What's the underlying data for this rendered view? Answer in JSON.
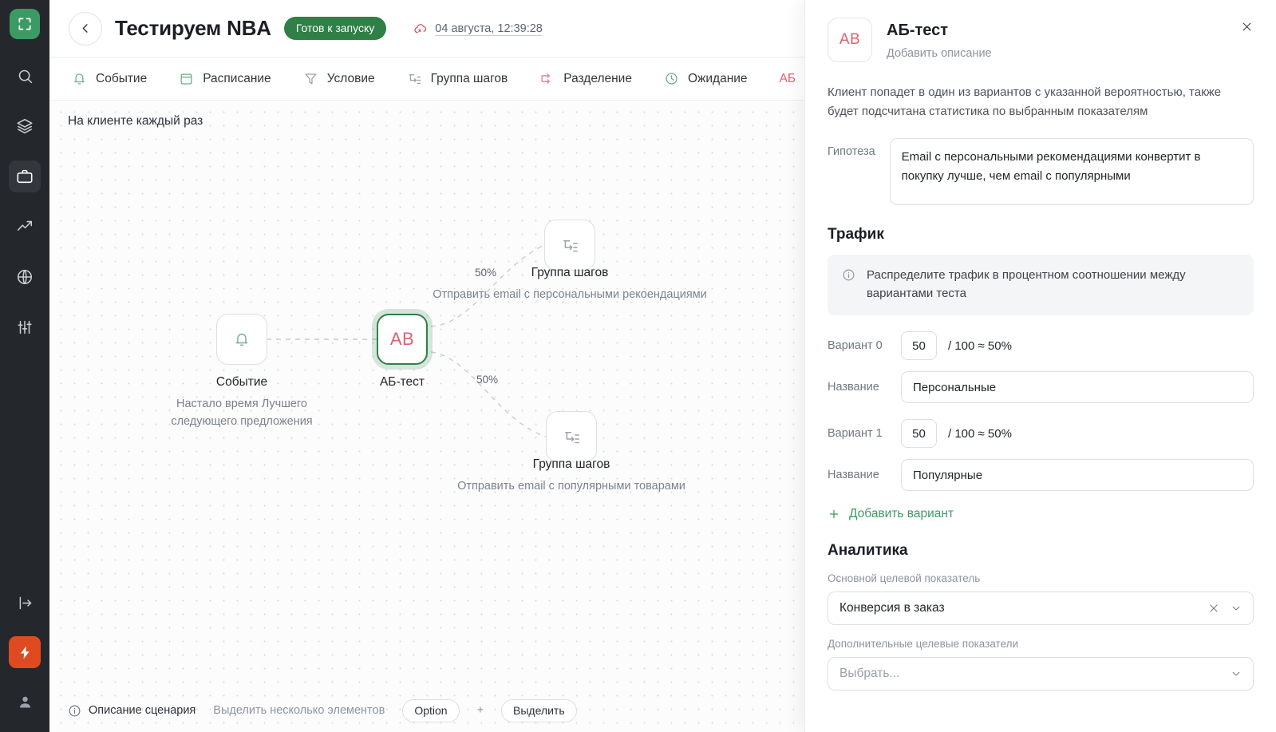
{
  "rail": {
    "logo": "app-logo",
    "items": [
      {
        "name": "search-icon"
      },
      {
        "name": "layers-icon"
      },
      {
        "name": "briefcase-icon",
        "active": true
      },
      {
        "name": "trending-up-icon"
      },
      {
        "name": "globe-icon"
      },
      {
        "name": "sliders-icon"
      }
    ],
    "bottom": [
      {
        "name": "logout-icon"
      },
      {
        "name": "lightning-icon"
      },
      {
        "name": "user-icon"
      }
    ]
  },
  "header": {
    "back_label": "←",
    "title": "Тестируем NBA",
    "status": "Готов к запуску",
    "saved_time": "04 августа, 12:39:28",
    "status_color": "#2f7f46",
    "cloud_color": "#e04a58"
  },
  "toolbar": {
    "items": [
      {
        "label": "Событие",
        "icon": "bell-icon"
      },
      {
        "label": "Расписание",
        "icon": "calendar-icon"
      },
      {
        "label": "Условие",
        "icon": "filter-icon"
      },
      {
        "label": "Группа шагов",
        "icon": "steps-group-icon"
      },
      {
        "label": "Разделение",
        "icon": "split-icon"
      },
      {
        "label": "Ожидание",
        "icon": "clock-icon"
      },
      {
        "label": "АБ",
        "icon": "ab-icon"
      }
    ]
  },
  "canvas": {
    "label": "На клиенте каждый раз",
    "nodes": [
      {
        "id": "event",
        "title": "Событие",
        "subtitle": "Настало время Лучшего следующего предложения",
        "icon": "bell-icon",
        "selected": false
      },
      {
        "id": "abtest",
        "title": "АБ-тест",
        "subtitle": "",
        "icon": "ab-icon",
        "selected": true
      },
      {
        "id": "group-top",
        "title": "Группа шагов",
        "subtitle": "Отправить email с персональными рекоендациями",
        "icon": "steps-group-icon",
        "selected": false
      },
      {
        "id": "group-bottom",
        "title": "Группа шагов",
        "subtitle": "Отправить email с популярными товарами",
        "icon": "steps-group-icon",
        "selected": false
      }
    ],
    "edge_labels": [
      "50%",
      "50%"
    ],
    "footer": {
      "description_label": "Описание сценария",
      "hint": "Выделить несколько элементов",
      "key1": "Option",
      "plus": "+",
      "key2": "Выделить"
    }
  },
  "panel": {
    "avatar_text": "AB",
    "title": "АБ-тест",
    "description_placeholder": "Добавить описание",
    "close_label": "×",
    "intro": "Клиент попадет в один из вариантов с указанной вероятностью, также будет подсчитана статистика по выбранным показателям",
    "hypothesis_label": "Гипотеза",
    "hypothesis_value": "Email с персональными рекомендациями конвертит в покупку лучше, чем email с популярными",
    "traffic_title": "Трафик",
    "traffic_info": "Распределите трафик в процентном соотношении между вариантами теста",
    "variants": [
      {
        "label": "Вариант 0",
        "value": "50",
        "fraction": "/ 100 ≈ 50%",
        "name_label": "Название",
        "name_value": "Персональные"
      },
      {
        "label": "Вариант 1",
        "value": "50",
        "fraction": "/ 100 ≈ 50%",
        "name_label": "Название",
        "name_value": "Популярные"
      }
    ],
    "add_variant": "Добавить вариант",
    "analytics_title": "Аналитика",
    "primary_metric_label": "Основной целевой показатель",
    "primary_metric_value": "Конверсия в заказ",
    "extra_metric_label": "Дополнительные целевые показатели",
    "extra_metric_placeholder": "Выбрать..."
  }
}
